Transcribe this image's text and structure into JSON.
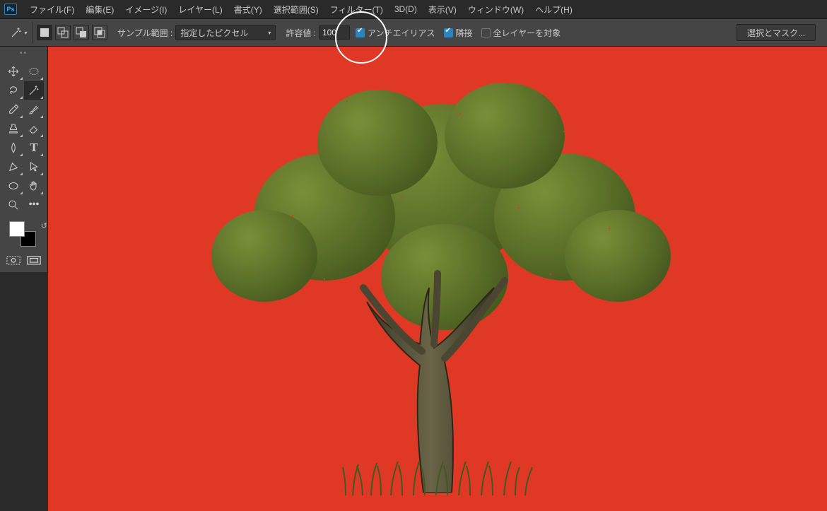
{
  "app_abbrev": "Ps",
  "menu": [
    "ファイル(F)",
    "編集(E)",
    "イメージ(I)",
    "レイヤー(L)",
    "書式(Y)",
    "選択範囲(S)",
    "フィルター(T)",
    "3D(D)",
    "表示(V)",
    "ウィンドウ(W)",
    "ヘルプ(H)"
  ],
  "options": {
    "sample_label": "サンプル範囲 :",
    "sample_value": "指定したピクセル",
    "tolerance_label": "許容値 :",
    "tolerance_value": "100",
    "antialias_label": "アンチエイリアス",
    "antialias_checked": true,
    "contiguous_label": "隣接",
    "contiguous_checked": true,
    "all_layers_label": "全レイヤーを対象",
    "all_layers_checked": false,
    "select_mask_button": "選択とマスク..."
  },
  "colors": {
    "canvas_bg": "#df3926",
    "foreground": "#ffffff",
    "background": "#000000"
  }
}
